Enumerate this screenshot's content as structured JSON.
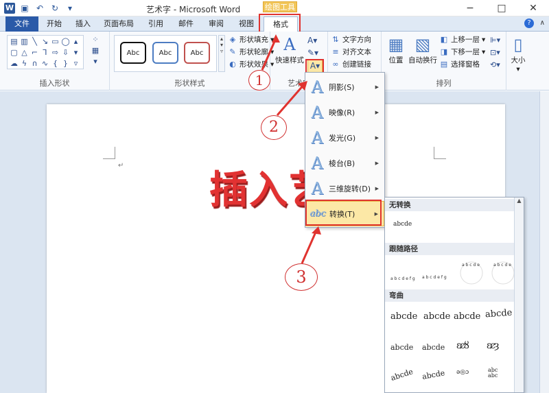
{
  "titlebar": {
    "app_icon": "W",
    "title": "艺术字 - Microsoft Word",
    "context_label": "绘图工具",
    "controls": [
      "−",
      "□",
      "✕"
    ]
  },
  "tabs": {
    "file": "文件",
    "items": [
      "开始",
      "插入",
      "页面布局",
      "引用",
      "邮件",
      "审阅",
      "视图"
    ],
    "active": "格式"
  },
  "ribbon": {
    "insert_shapes_label": "插入形状",
    "shape_styles_label": "形状样式",
    "arrange_label": "排列",
    "style_samples": [
      "Abc",
      "Abc",
      "Abc"
    ],
    "shape_fill": "形状填充",
    "shape_outline": "形状轮廓",
    "shape_effect": "形状效果",
    "quick_styles": "快速样式",
    "wordart_label": "艺术字",
    "text_direction": "文字方向",
    "align_text": "对齐文本",
    "create_link": "创建链接",
    "position": "位置",
    "wrap_text": "自动换行",
    "bring_forward": "上移一层",
    "send_backward": "下移一层",
    "selection_pane": "选择窗格",
    "size": "大小"
  },
  "document": {
    "wordart_text": "插入艺术"
  },
  "menu": {
    "items": [
      {
        "label": "阴影(S)"
      },
      {
        "label": "映像(R)"
      },
      {
        "label": "发光(G)"
      },
      {
        "label": "棱台(B)"
      },
      {
        "label": "三维旋转(D)"
      },
      {
        "label": "转换(T)"
      }
    ]
  },
  "submenu": {
    "no_transform": "无转换",
    "no_transform_sample": "abcde",
    "follow_path": "跟随路径",
    "warp": "弯曲",
    "warp_samples": [
      "abcde",
      "abcde",
      "abcde",
      "abcde",
      "abcde",
      "abcde"
    ]
  },
  "annotations": [
    "1",
    "2",
    "3"
  ]
}
